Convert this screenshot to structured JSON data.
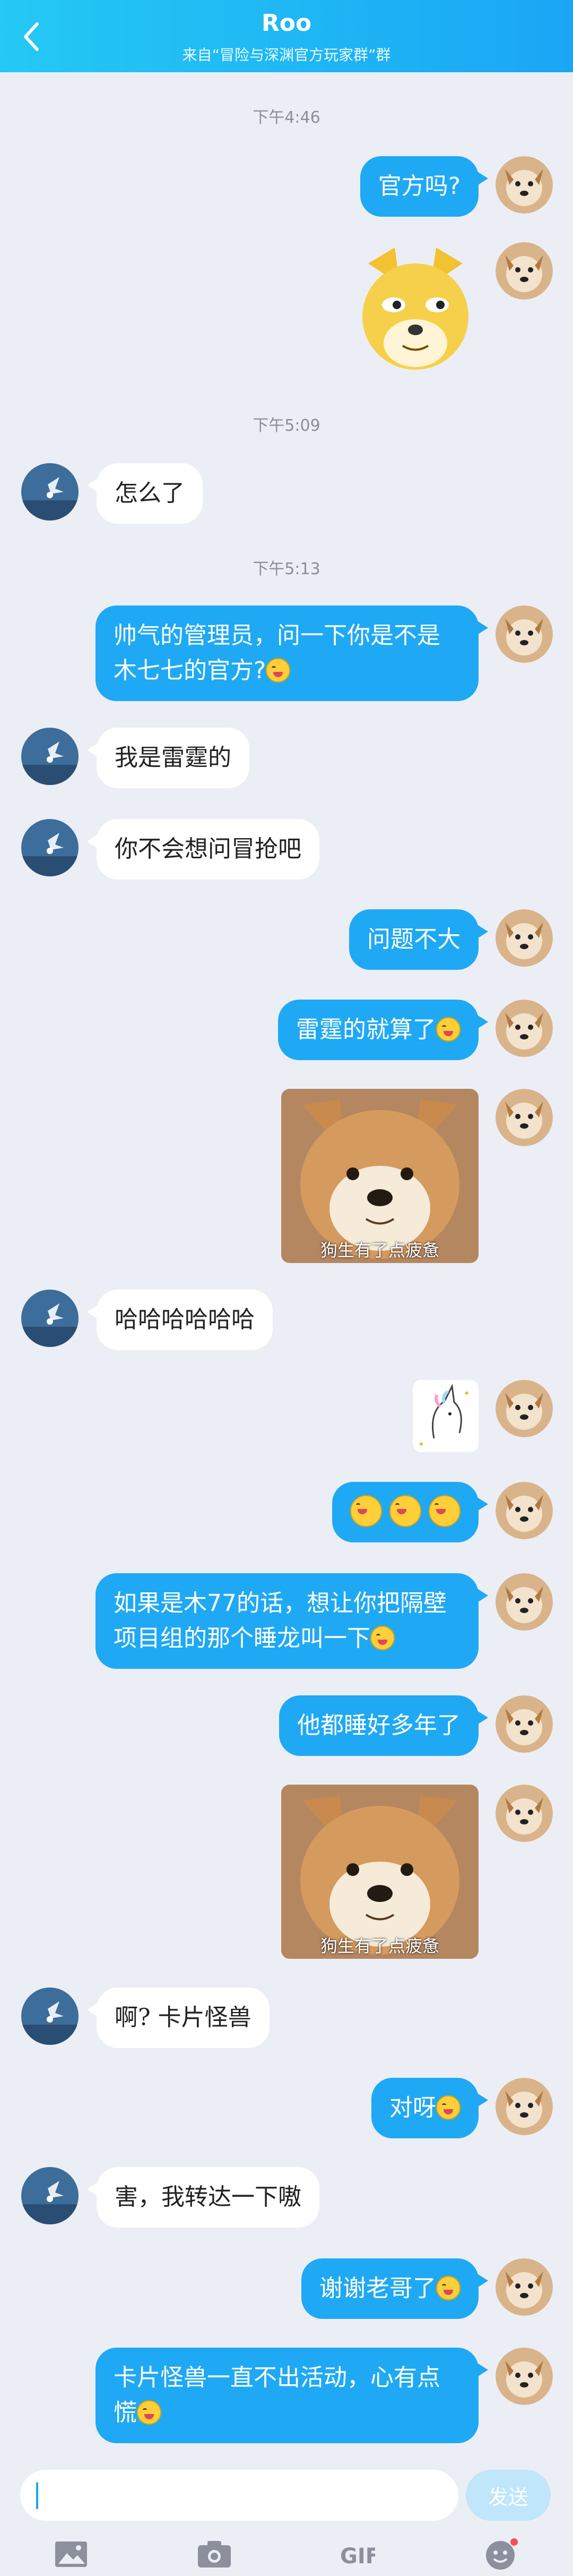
{
  "header": {
    "title": "Roo",
    "subtitle": "来自“冒险与深渊官方玩家群”群"
  },
  "timestamps": [
    "下午4:46",
    "下午5:09",
    "下午5:13"
  ],
  "messages": {
    "m1": "官方吗?",
    "m3": "怎么了",
    "m4": "帅气的管理员，问一下你是不是木七七的官方?",
    "m5": "我是雷霆的",
    "m6": "你不会想问冒抢吧",
    "m7": "问题不大",
    "m8": "雷霆的就算了",
    "m9_caption": "狗生有了点疲惫",
    "m10": "哈哈哈哈哈哈",
    "m13": "如果是木77的话，想让你把隔壁项目组的那个睡龙叫一下",
    "m14": "他都睡好多年了",
    "m15_caption": "狗生有了点疲惫",
    "m16": "啊? 卡片怪兽",
    "m17": "对呀",
    "m18": "害，我转达一下嗷",
    "m19": "谢谢老哥了",
    "m20": "卡片怪兽一直不出活动，心有点慌"
  },
  "input": {
    "send_label": "发送"
  },
  "colors": {
    "header_start": "#24c9f4",
    "header_end": "#1aa6f5",
    "bubble_me": "#1fa9f4",
    "bubble_them": "#ffffff",
    "background": "#eceef6"
  },
  "icons": [
    "back-arrow-icon",
    "image-icon",
    "camera-icon",
    "gif-icon",
    "emoji-icon"
  ]
}
